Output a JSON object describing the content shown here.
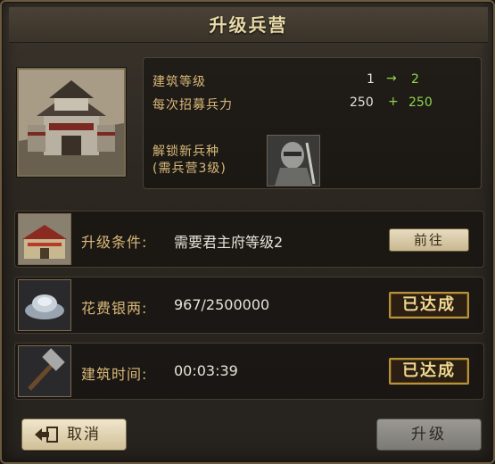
{
  "dialog": {
    "title": "升级兵营"
  },
  "building": {
    "level_label": "建筑等级",
    "level_current": "1",
    "level_next": "2",
    "recruit_label": "每次招募兵力",
    "recruit_current": "250",
    "recruit_bonus": "250",
    "unlock_label_line1": "解锁新兵种",
    "unlock_label_line2": "(需兵营3级)"
  },
  "requirements": [
    {
      "label": "升级条件:",
      "value": "需要君主府等级2",
      "action": "前往"
    },
    {
      "label": "花费银两:",
      "value": "967/2500000",
      "status": "已达成"
    },
    {
      "label": "建筑时间:",
      "value": "00:03:39",
      "status": "已达成"
    }
  ],
  "footer": {
    "cancel_label": "取消",
    "upgrade_label": "升级"
  },
  "colors": {
    "gold_label": "#d8b878",
    "green_value": "#8fd44a",
    "badge_border": "#b8923a"
  }
}
